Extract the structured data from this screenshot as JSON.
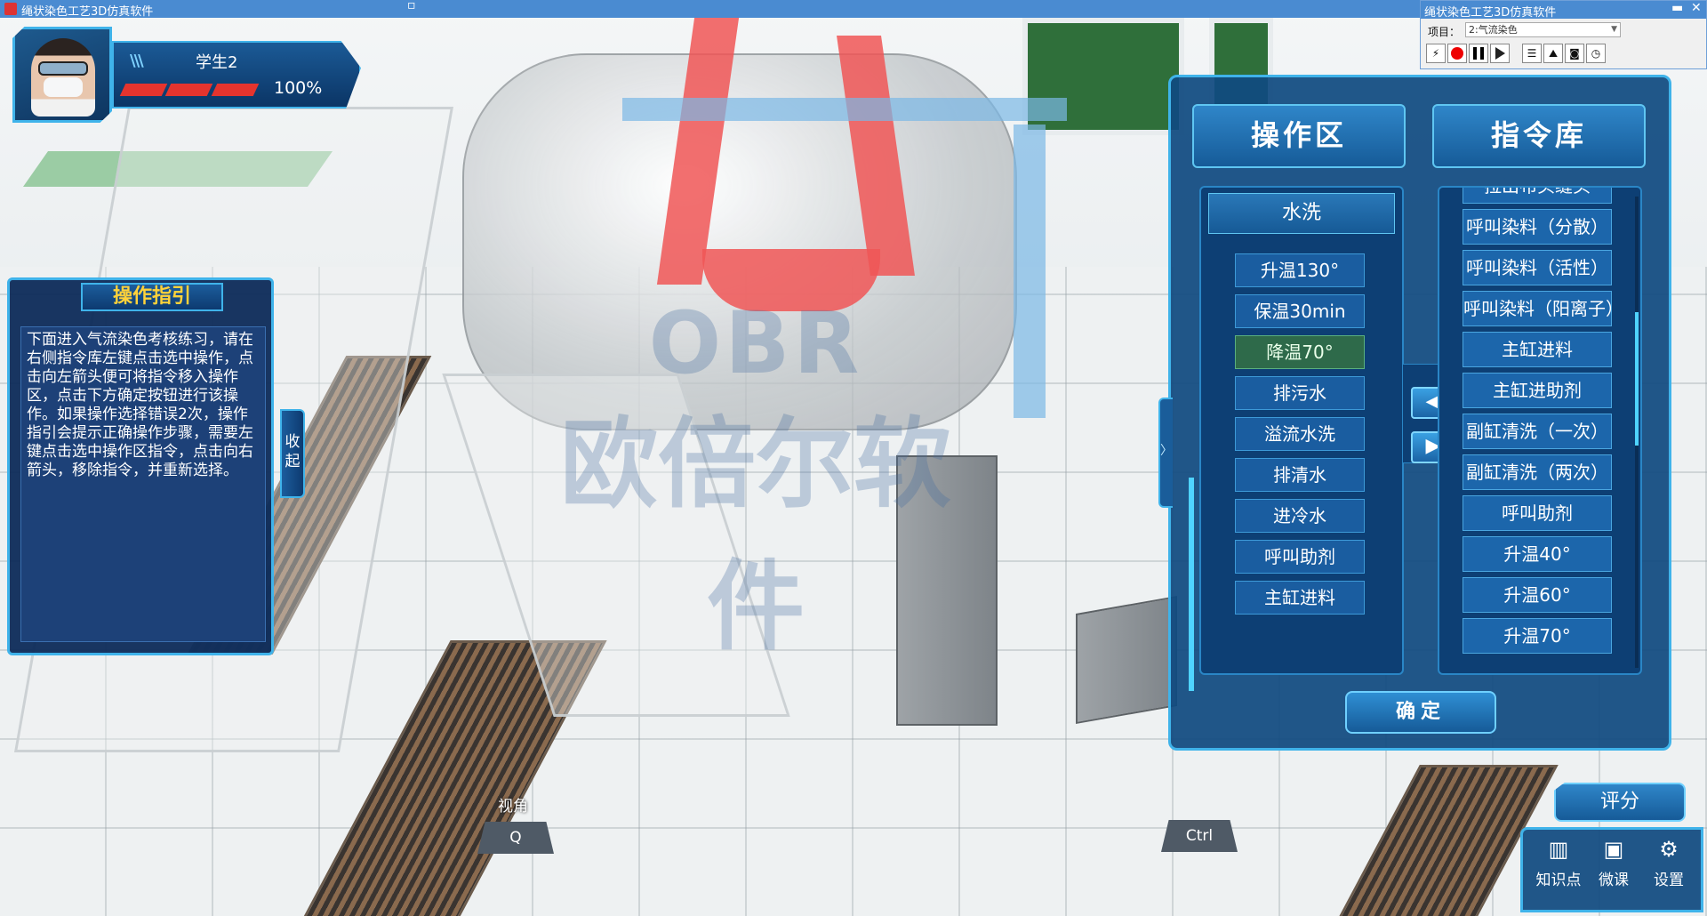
{
  "window": {
    "title": "绳状染色工艺3D仿真软件",
    "minimize_glyph": "▫"
  },
  "sub_window": {
    "title": "绳状染色工艺3D仿真软件",
    "minimize_glyph": "▬",
    "close_glyph": "✕",
    "project_label": "项目：",
    "project_value": "2:气流染色",
    "toolbar_icons": [
      "fast-forward-icon",
      "record-icon",
      "pause-icon",
      "play-icon",
      "list-icon",
      "chart-icon",
      "camera-icon",
      "clock-icon"
    ]
  },
  "user": {
    "name": "学生2",
    "health_percent_text": "100%",
    "health_fraction": 1.0,
    "role_tag": "ROLE"
  },
  "guide": {
    "title": "操作指引",
    "text": "下面进入气流染色考核练习，请在右侧指令库左键点击选中操作，点击向左箭头便可将指令移入操作区，点击下方确定按钮进行该操作。如果操作选择错误2次，操作指引会提示正确操作步骤，需要左键点击选中操作区指令，点击向右箭头，移除指令，并重新选择。",
    "collapse_label": "收起"
  },
  "operation_panel": {
    "ops_header": "操作区",
    "lib_header": "指令库",
    "ops_group": "水洗",
    "ops_items": [
      "升温130°",
      "保温30min",
      "降温70°",
      "排污水",
      "溢流水洗",
      "排清水",
      "进冷水",
      "呼叫助剂",
      "主缸进料"
    ],
    "ops_selected_index": 2,
    "lib_items": [
      "拉出布头缝头",
      "呼叫染料（分散）",
      "呼叫染料（活性）",
      "呼叫染料（阳离子）",
      "主缸进料",
      "主缸进助剂",
      "副缸清洗（一次）",
      "副缸清洗（两次）",
      "呼叫助剂",
      "升温40°",
      "升温60°",
      "升温70°"
    ],
    "move_left_glyph": "◀",
    "move_right_glyph": "▶",
    "edge_glyph": "〉",
    "confirm_label": "确定"
  },
  "score_label": "评分",
  "tools": [
    {
      "label": "知识点",
      "icon": "book-icon",
      "glyph": "▥"
    },
    {
      "label": "微课",
      "icon": "folder-icon",
      "glyph": "▣"
    },
    {
      "label": "设置",
      "icon": "gear-icon",
      "glyph": "⚙"
    }
  ],
  "hints": {
    "view_label": "视角",
    "key_q": "Q",
    "key_ctrl": "Ctrl"
  },
  "watermark": {
    "latin": "OBR",
    "cn": "欧倍尔软件"
  },
  "colors": {
    "accent": "#3fb3ea",
    "panel": "#104a80",
    "guide_title": "#ffd23a",
    "health": "#e5342e"
  }
}
